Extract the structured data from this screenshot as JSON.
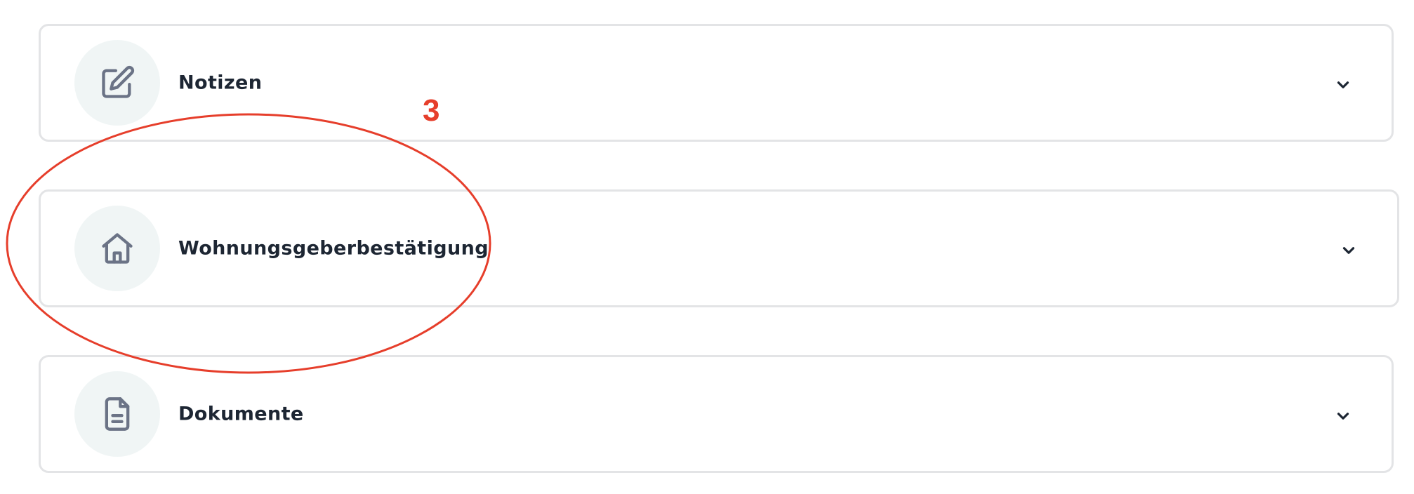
{
  "sections": [
    {
      "id": "notes",
      "label": "Notizen",
      "icon": "edit-icon"
    },
    {
      "id": "landlord",
      "label": "Wohnungsgeberbestätigung",
      "icon": "house-icon"
    },
    {
      "id": "documents",
      "label": "Dokumente",
      "icon": "document-icon"
    }
  ],
  "annotation": {
    "number": "3",
    "color": "#e63e2b"
  },
  "colors": {
    "card_border": "#e3e4e6",
    "icon_circle": "#f0f5f5",
    "icon_stroke": "#6b7386",
    "label_text": "#1d2633"
  }
}
